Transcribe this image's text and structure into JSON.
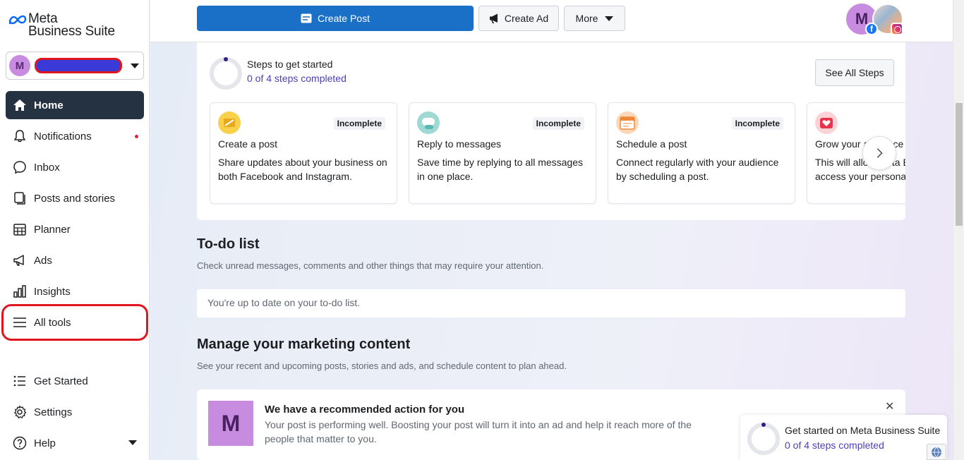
{
  "app": {
    "brand_line1": "Meta",
    "brand_line2": "Business Suite"
  },
  "account": {
    "avatar_letter": "M"
  },
  "sidebar": {
    "items": [
      {
        "label": "Home",
        "icon": "home-icon"
      },
      {
        "label": "Notifications",
        "icon": "bell-icon"
      },
      {
        "label": "Inbox",
        "icon": "chat-bubble-icon"
      },
      {
        "label": "Posts and stories",
        "icon": "posts-icon"
      },
      {
        "label": "Planner",
        "icon": "calendar-icon"
      },
      {
        "label": "Ads",
        "icon": "megaphone-icon"
      },
      {
        "label": "Insights",
        "icon": "bar-chart-icon"
      },
      {
        "label": "All tools",
        "icon": "menu-icon"
      }
    ],
    "bottom": [
      {
        "label": "Get Started",
        "icon": "checklist-icon"
      },
      {
        "label": "Settings",
        "icon": "gear-icon"
      },
      {
        "label": "Help",
        "icon": "help-icon"
      }
    ]
  },
  "topbar": {
    "create_post": "Create Post",
    "create_ad": "Create Ad",
    "more": "More",
    "avatar_letter": "M",
    "fb_letter": "f"
  },
  "steps": {
    "title": "Steps to get started",
    "subtitle": "0 of 4 steps completed",
    "see_all": "See All Steps",
    "cards": [
      {
        "status": "Incomplete",
        "title": "Create a post",
        "desc": "Share updates about your business on both Facebook and Instagram."
      },
      {
        "status": "Incomplete",
        "title": "Reply to messages",
        "desc": "Save time by replying to all messages in one place."
      },
      {
        "status": "Incomplete",
        "title": "Schedule a post",
        "desc": "Connect regularly with your audience by scheduling a post."
      },
      {
        "status": "",
        "title": "Grow your audience",
        "desc": "This will allow Meta Business Suite to access your personal"
      }
    ]
  },
  "todo": {
    "title": "To-do list",
    "subtitle": "Check unread messages, comments and other things that may require your attention.",
    "empty": "You're up to date on your to-do list."
  },
  "marketing": {
    "title": "Manage your marketing content",
    "subtitle": "See your recent and upcoming posts, stories and ads, and schedule content to plan ahead.",
    "reco_avatar": "M",
    "reco_title": "We have a recommended action for you",
    "reco_desc": "Your post is performing well. Boosting your post will turn it into an ad and help it reach more of the people that matter to you.",
    "close": "✕"
  },
  "floating": {
    "title": "Get started on Meta Business Suite",
    "subtitle": "0 of 4 steps completed"
  },
  "colors": {
    "primary": "#1a6fc7",
    "sidebar_active": "#253241",
    "accent_purple": "#4b3fb8",
    "annotation_red": "#e0161f"
  }
}
